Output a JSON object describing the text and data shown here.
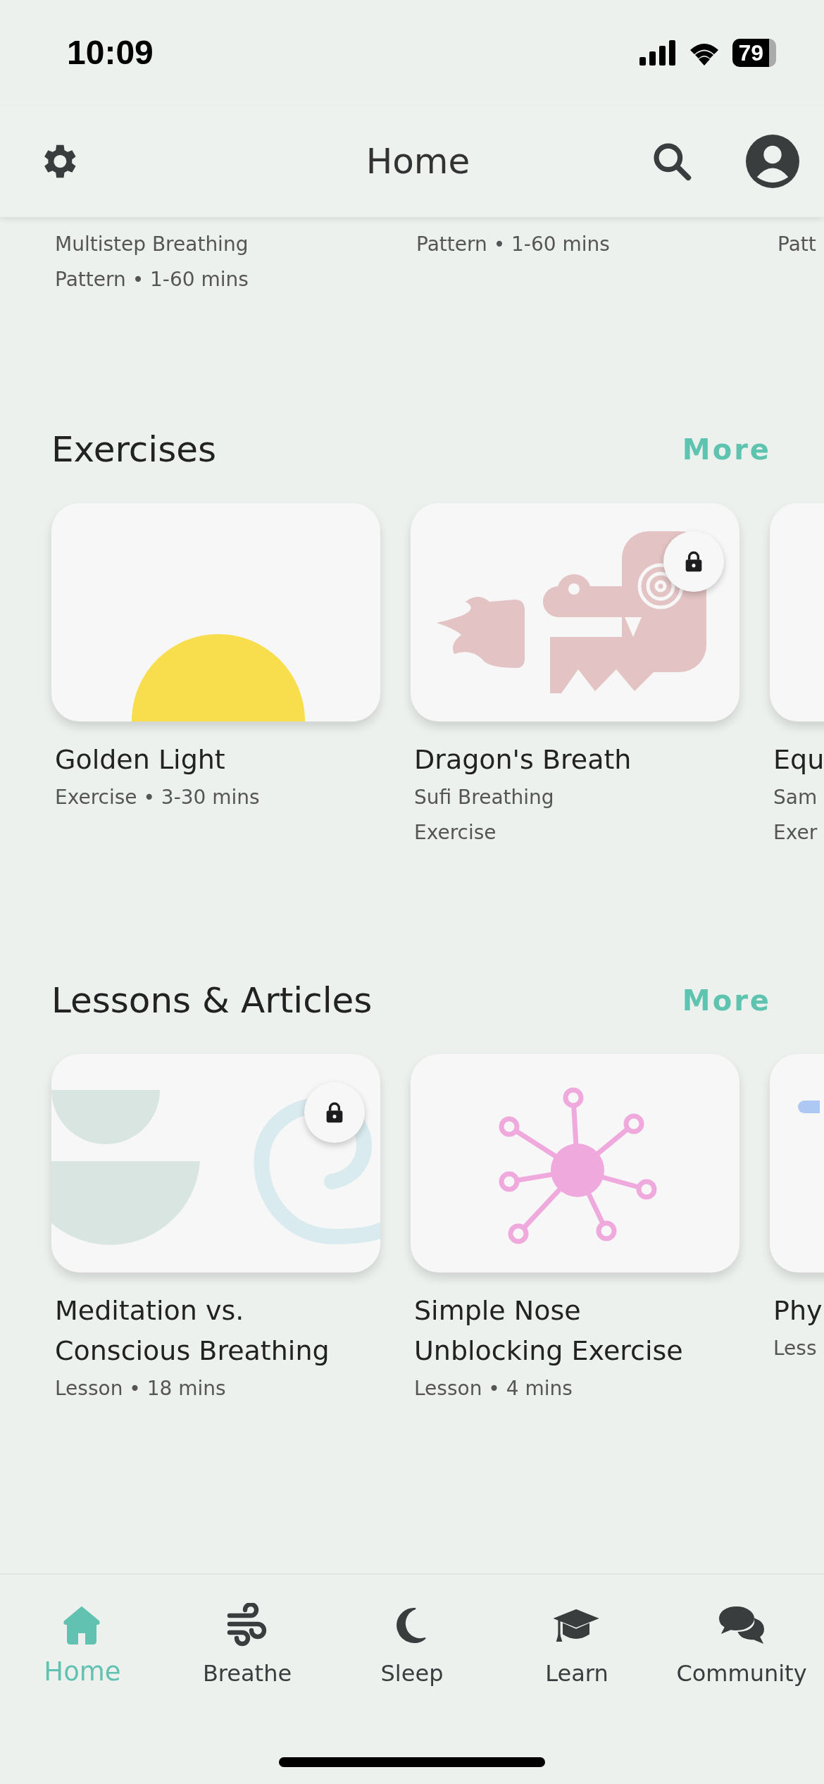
{
  "status_bar": {
    "time": "10:09",
    "battery": "79"
  },
  "header": {
    "title": "Home"
  },
  "patterns": [
    {
      "subtitle": "Multistep Breathing",
      "meta": "Pattern • 1-60 mins"
    },
    {
      "meta": "Pattern • 1-60 mins"
    },
    {
      "meta": "Patt"
    }
  ],
  "sections": [
    {
      "title": "Exercises",
      "more": "More",
      "cards": [
        {
          "locked": false,
          "title": "Golden Light",
          "lines": [
            "Exercise • 3-30 mins"
          ]
        },
        {
          "locked": true,
          "title": "Dragon's Breath",
          "lines": [
            "Sufi Breathing",
            "Exercise"
          ]
        },
        {
          "locked": false,
          "title": "Equ",
          "lines": [
            "Sam",
            "Exer"
          ]
        }
      ]
    },
    {
      "title": "Lessons & Articles",
      "more": "More",
      "cards": [
        {
          "locked": true,
          "title": "Meditation vs. Conscious Breathing",
          "lines": [
            "Lesson • 18 mins"
          ]
        },
        {
          "locked": false,
          "title": "Simple Nose Unblocking Exercise",
          "lines": [
            "Lesson • 4 mins"
          ]
        },
        {
          "locked": false,
          "title": "Phy",
          "lines": [
            "Less"
          ]
        }
      ]
    }
  ],
  "nav": [
    {
      "label": "Home",
      "selected": true
    },
    {
      "label": "Breathe",
      "selected": false
    },
    {
      "label": "Sleep",
      "selected": false
    },
    {
      "label": "Learn",
      "selected": false
    },
    {
      "label": "Community",
      "selected": false
    }
  ]
}
